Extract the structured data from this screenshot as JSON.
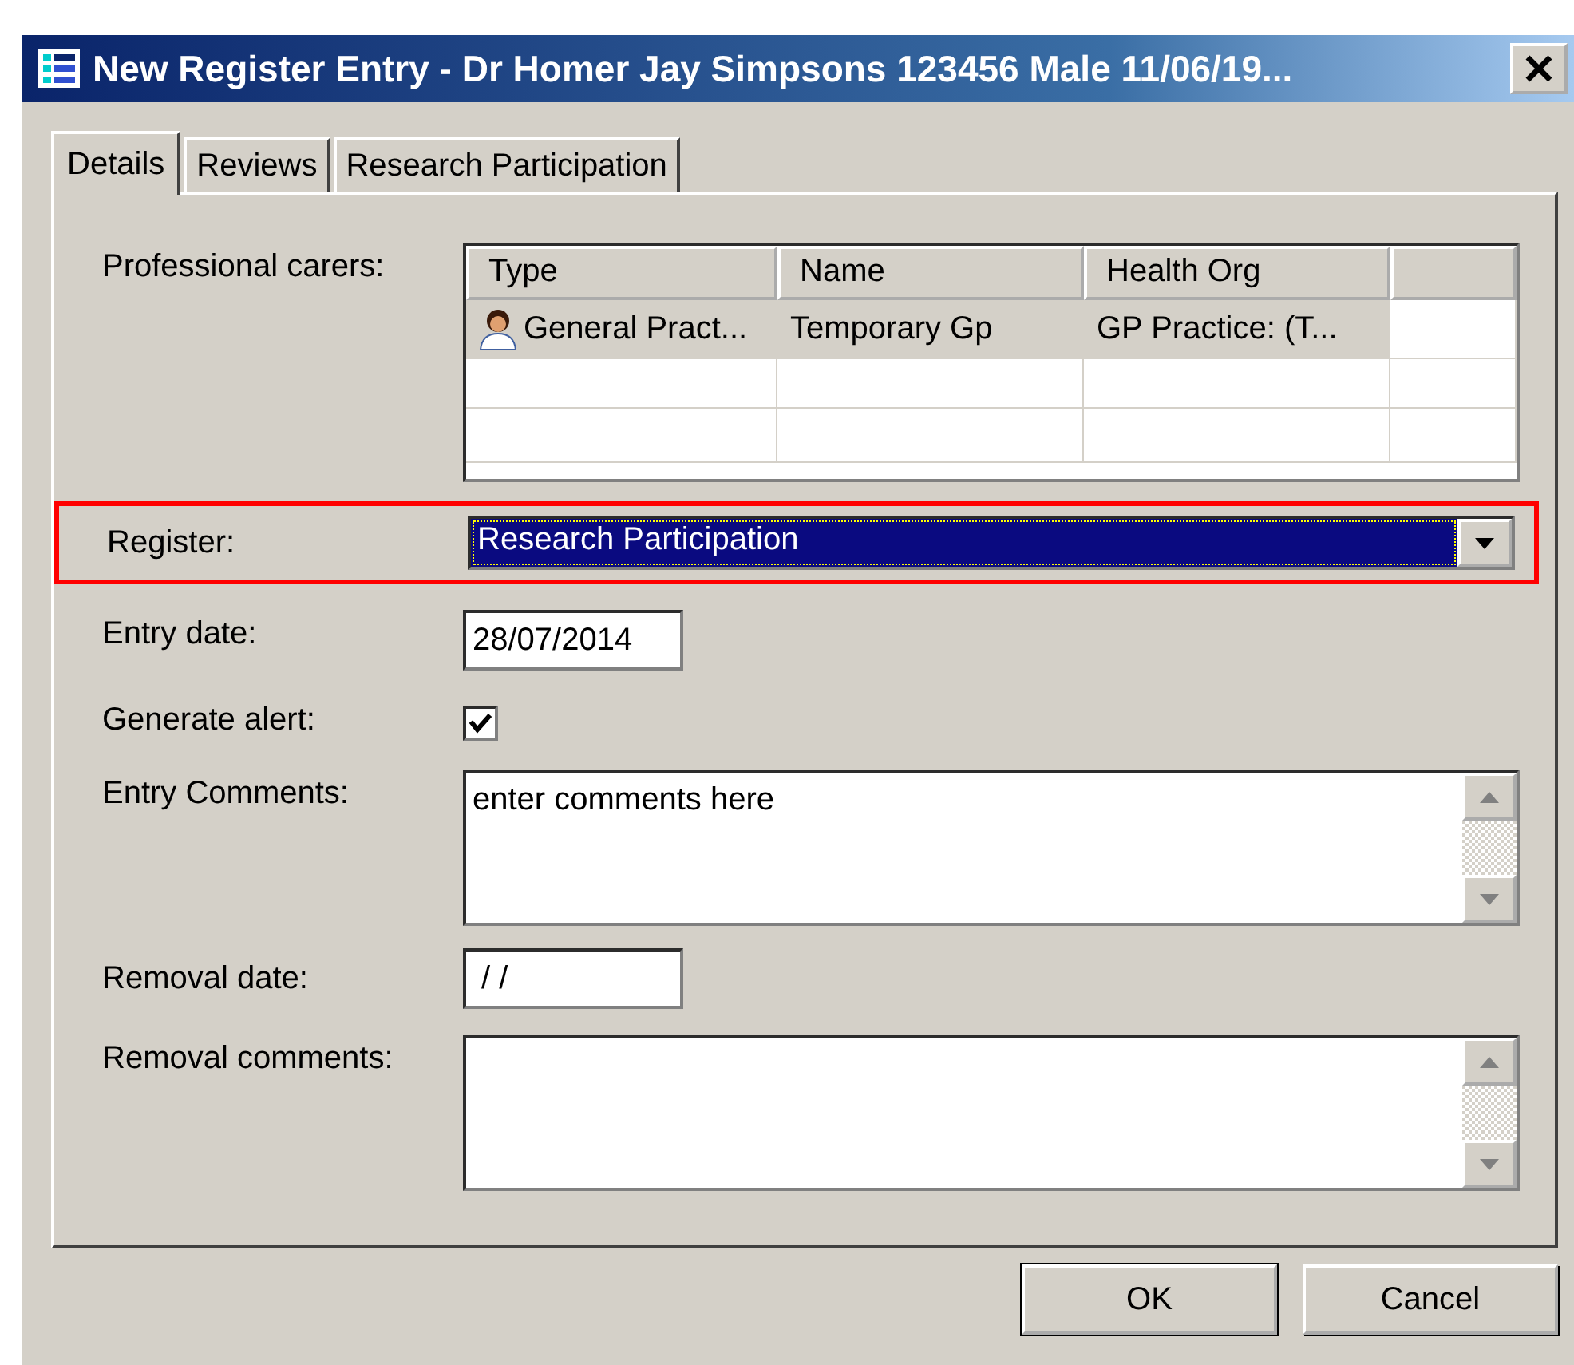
{
  "window": {
    "title": "New Register Entry - Dr Homer Jay Simpsons 123456 Male 11/06/19..."
  },
  "tabs": [
    {
      "label": "Details",
      "selected": true
    },
    {
      "label": "Reviews",
      "selected": false
    },
    {
      "label": "Research Participation",
      "selected": false
    }
  ],
  "professional_carers": {
    "label": "Professional carers:",
    "columns": [
      "Type",
      "Name",
      "Health Org"
    ],
    "rows": [
      {
        "type": "General Pract...",
        "name": "Temporary Gp",
        "health_org": "GP Practice: (T...",
        "selected": true
      }
    ]
  },
  "register": {
    "label": "Register:",
    "value": "Research Participation",
    "highlighted": true
  },
  "entry_date": {
    "label": "Entry date:",
    "value": "28/07/2014"
  },
  "generate_alert": {
    "label": "Generate alert:",
    "checked": true
  },
  "entry_comments": {
    "label": "Entry Comments:",
    "value": "enter comments here"
  },
  "removal_date": {
    "label": "Removal date:",
    "value": " / /"
  },
  "removal_comments": {
    "label": "Removal comments:"
  },
  "buttons": [
    "OK",
    "Cancel"
  ]
}
